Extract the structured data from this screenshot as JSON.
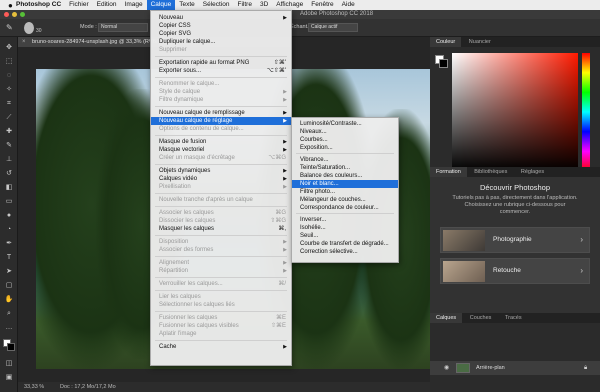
{
  "mac_menubar": {
    "app": "Photoshop CC",
    "items": [
      "Fichier",
      "Edition",
      "Image",
      "Calque",
      "Texte",
      "Sélection",
      "Filtre",
      "3D",
      "Affichage",
      "Fenêtre",
      "Aide"
    ],
    "active": "Calque"
  },
  "window": {
    "title": "Adobe Photoshop CC 2018"
  },
  "options_bar": {
    "size": "30",
    "mode_label": "Mode :",
    "mode_value": "Normal",
    "sample_label": "Échant. :",
    "sample_value": "Calque actif"
  },
  "document": {
    "tab_title": "bruno-soares-284974-unsplash.jpg @ 33,3% (RVB/8)",
    "zoom": "33,33 %",
    "doc_size": "Doc : 17,2 Mo/17,2 Mo"
  },
  "right_panels": {
    "color_tabs": [
      "Couleur",
      "Nuancier"
    ],
    "learn_tabs": [
      "Formation",
      "Bibliothèques",
      "Réglages"
    ],
    "learn_title": "Découvrir Photoshop",
    "learn_desc": "Tutoriels pas à pas, directement dans l'application. Choisissez une rubrique ci-dessous pour commencer.",
    "cards": [
      "Photographie",
      "Retouche"
    ],
    "layers_tabs": [
      "Calques",
      "Couches",
      "Tracés"
    ],
    "layer_name": "Arrière-plan"
  },
  "calque_menu": {
    "items": [
      {
        "label": "Nouveau",
        "sub": true
      },
      {
        "label": "Copier CSS",
        "dis": false
      },
      {
        "label": "Copier SVG"
      },
      {
        "label": "Dupliquer le calque..."
      },
      {
        "label": "Supprimer",
        "dis": true
      },
      {
        "label": "Exportation rapide au format PNG",
        "shortcut": "⇧⌘'"
      },
      {
        "label": "Exporter sous...",
        "shortcut": "⌥⇧⌘'"
      },
      {
        "label": "Renommer le calque...",
        "dis": true
      },
      {
        "label": "Style de calque",
        "dis": true,
        "sub": true
      },
      {
        "label": "Filtre dynamique",
        "dis": true,
        "sub": true
      },
      {
        "label": "Nouveau calque de remplissage",
        "sub": true
      },
      {
        "label": "Nouveau calque de réglage",
        "sub": true,
        "hl": true
      },
      {
        "label": "Options de contenu de calque...",
        "dis": true
      },
      {
        "label": "Masque de fusion",
        "sub": true
      },
      {
        "label": "Masque vectoriel",
        "sub": true
      },
      {
        "label": "Créer un masque d'écrêtage",
        "dis": true,
        "shortcut": "⌥⌘G"
      },
      {
        "label": "Objets dynamiques",
        "sub": true
      },
      {
        "label": "Calques vidéo",
        "sub": true
      },
      {
        "label": "Pixellisation",
        "dis": true,
        "sub": true
      },
      {
        "label": "Nouvelle tranche d'après un calque",
        "dis": true
      },
      {
        "label": "Associer les calques",
        "dis": true,
        "shortcut": "⌘G"
      },
      {
        "label": "Dissocier les calques",
        "dis": true,
        "shortcut": "⇧⌘G"
      },
      {
        "label": "Masquer les calques",
        "shortcut": "⌘,"
      },
      {
        "label": "Disposition",
        "dis": true,
        "sub": true
      },
      {
        "label": "Associer des formes",
        "dis": true,
        "sub": true
      },
      {
        "label": "Alignement",
        "dis": true,
        "sub": true
      },
      {
        "label": "Répartition",
        "dis": true,
        "sub": true
      },
      {
        "label": "Verrouiller les calques...",
        "dis": true,
        "shortcut": "⌘/"
      },
      {
        "label": "Lier les calques",
        "dis": true
      },
      {
        "label": "Sélectionner les calques liés",
        "dis": true
      },
      {
        "label": "Fusionner les calques",
        "dis": true,
        "shortcut": "⌘E"
      },
      {
        "label": "Fusionner les calques visibles",
        "dis": true,
        "shortcut": "⇧⌘E"
      },
      {
        "label": "Aplatir l'image",
        "dis": true
      },
      {
        "label": "Cache",
        "sub": true
      }
    ]
  },
  "adjust_submenu": {
    "items": [
      {
        "label": "Luminosité/Contraste..."
      },
      {
        "label": "Niveaux..."
      },
      {
        "label": "Courbes..."
      },
      {
        "label": "Exposition..."
      },
      {
        "label": "Vibrance..."
      },
      {
        "label": "Teinte/Saturation..."
      },
      {
        "label": "Balance des couleurs..."
      },
      {
        "label": "Noir et blanc...",
        "hl": true
      },
      {
        "label": "Filtre photo..."
      },
      {
        "label": "Mélangeur de couches..."
      },
      {
        "label": "Correspondance de couleur..."
      },
      {
        "label": "Inverser..."
      },
      {
        "label": "Isohélie..."
      },
      {
        "label": "Seuil..."
      },
      {
        "label": "Courbe de transfert de dégradé..."
      },
      {
        "label": "Correction sélective..."
      }
    ]
  }
}
